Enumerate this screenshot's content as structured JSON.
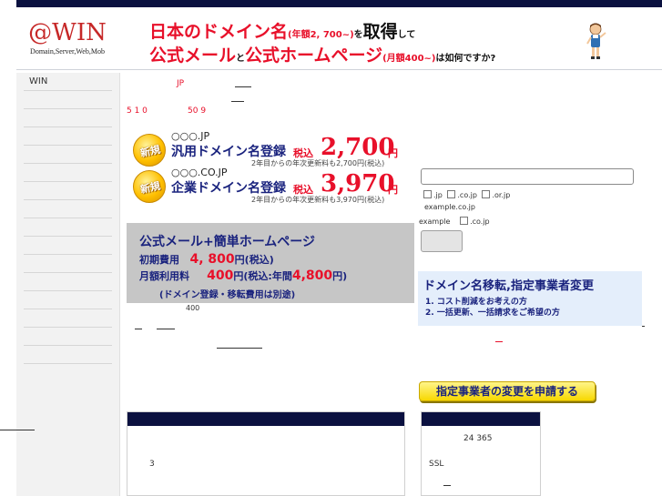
{
  "header": {
    "logo_main": "@WIN",
    "logo_sub": "Domain,Server,Web,Mob",
    "line1_big": "日本のドメイン名",
    "line1_small": "(年額2, 700~)",
    "line1_connector": "を",
    "line1_tail_big": "取得",
    "line1_tail_small": "して",
    "line2_big1": "公式メール",
    "line2_connector": "と",
    "line2_big2": "公式ホームページ",
    "line2_small": "(月額400~)",
    "line2_tail": "は如何ですか?"
  },
  "sidebar": {
    "items": [
      "WIN",
      "",
      "",
      "",
      "",
      "",
      "",
      "",
      "",
      "",
      "",
      "",
      "",
      "",
      "",
      ""
    ]
  },
  "main": {
    "jp_text": "JP",
    "num_text": "5 1 0",
    "num_text2": "50  9",
    "products": [
      {
        "badge": "新規",
        "domain": "○○○.JP",
        "label": "汎用ドメイン名登録",
        "tax": "税込",
        "price": "2,700",
        "yen": "円",
        "note": "2年目からの年次更新料も2,700円(税込)"
      },
      {
        "badge": "新規",
        "domain": "○○○.CO.JP",
        "label": "企業ドメイン名登録",
        "tax": "税込",
        "price": "3,970",
        "yen": "円",
        "note": "2年目からの年次更新料も3,970円(税込)"
      }
    ],
    "plan": {
      "title": "公式メール+簡単ホームページ",
      "init_label": "初期費用",
      "init_price": "4, 800",
      "init_unit": "円(税込)",
      "monthly_label": "月額利用料",
      "monthly_price": "400",
      "monthly_unit": "円(税込:年間",
      "yearly_price": "4,800",
      "yearly_unit": "円)",
      "note": "(ドメイン登録・移転費用は別途)"
    },
    "plan_sub": "400",
    "bottom_left_text": "3"
  },
  "right": {
    "checkbox_options": [
      ".jp",
      ".co.jp",
      ".or.jp"
    ],
    "example1": "example.co.jp",
    "example2": "example",
    "example2_option": ".co.jp",
    "transfer": {
      "title": "ドメイン名移転,指定事業者変更",
      "line1": "1. コスト削減をお考えの方",
      "line2": "2. 一括更新、一括請求をご希望の方"
    },
    "apply_label": "指定事業者の変更を申請する",
    "info_box": {
      "line1": "24  365",
      "line2": "SSL"
    }
  },
  "colors": {
    "accent_red": "#e8102a",
    "navy": "#0b1140",
    "brand_blue": "#1a237e"
  }
}
